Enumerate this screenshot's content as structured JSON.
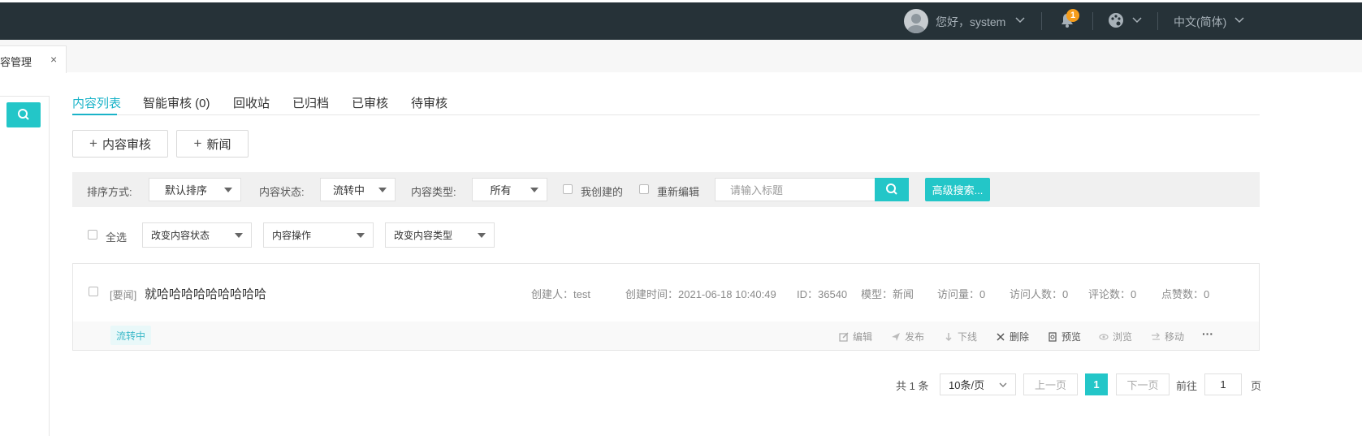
{
  "header": {
    "greeting": "您好，system",
    "notifications_count": "1",
    "language": "中文(简体)"
  },
  "page_tab": {
    "label": "容管理",
    "close": "×"
  },
  "tabs": [
    "内容列表",
    "智能审核 (0)",
    "回收站",
    "已归档",
    "已审核",
    "待审核"
  ],
  "actions": {
    "audit": "内容审核",
    "news": "新闻",
    "plus": "+"
  },
  "filters": {
    "sort_label": "排序方式:",
    "sort_value": "默认排序",
    "status_label": "内容状态:",
    "status_value": "流转中",
    "type_label": "内容类型:",
    "type_value": "所有",
    "mine_label": "我创建的",
    "reedit_label": "重新编辑",
    "title_placeholder": "请输入标题",
    "advanced": "高级搜索..."
  },
  "batch": {
    "select_all": "全选",
    "change_status": "改变内容状态",
    "content_ops": "内容操作",
    "change_type": "改变内容类型"
  },
  "item": {
    "tag": "[要闻]",
    "title": "就哈哈哈哈哈哈哈哈哈",
    "creator": "创建人：test",
    "created": "创建时间：2021-06-18 10:40:49",
    "id": "ID：36540",
    "model": "模型：新闻",
    "visits": "访问量：0",
    "visitors": "访问人数：0",
    "comments": "评论数：0",
    "likes": "点赞数：0",
    "status": "流转中",
    "ops": {
      "edit": "编辑",
      "publish": "发布",
      "offline": "下线",
      "delete": "删除",
      "preview": "预览",
      "browse": "浏览",
      "move": "移动",
      "more": "···"
    }
  },
  "pagination": {
    "total": "共 1 条",
    "page_size": "10条/页",
    "prev": "上一页",
    "current": "1",
    "next": "下一页",
    "goto": "前往",
    "goto_value": "1",
    "page_unit": "页"
  },
  "colors": {
    "header_bg": "#263238",
    "accent": "#23c6c8",
    "badge": "#f59d1b"
  }
}
